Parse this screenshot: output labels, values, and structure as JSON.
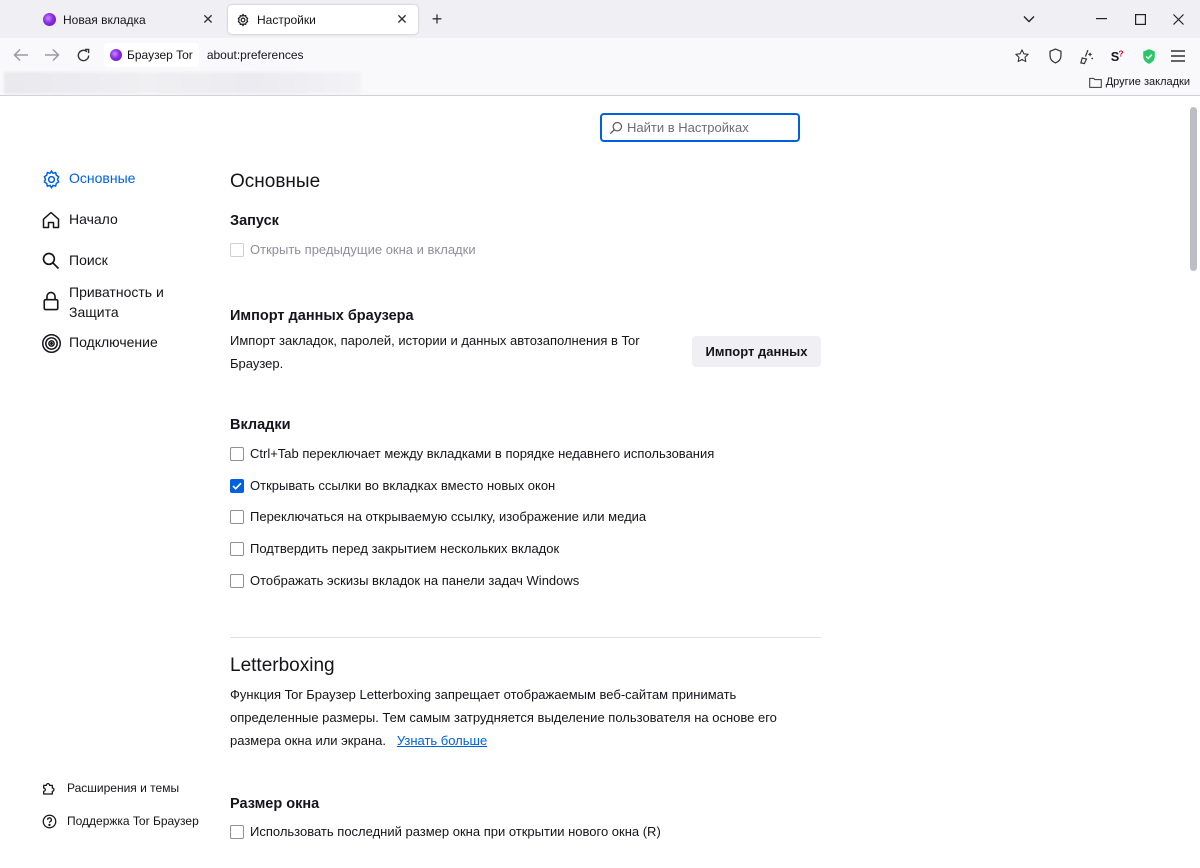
{
  "tabs": [
    {
      "label": "Новая вкладка",
      "active": false
    },
    {
      "label": "Настройки",
      "active": true
    }
  ],
  "navbar": {
    "identity_label": "Браузер Tor",
    "url": "about:preferences"
  },
  "bookmarks": {
    "other_label": "Другие закладки"
  },
  "search": {
    "placeholder": "Найти в Настройках"
  },
  "sidebar": {
    "items": [
      {
        "label": "Основные",
        "icon": "gear-icon",
        "selected": true
      },
      {
        "label": "Начало",
        "icon": "home-icon"
      },
      {
        "label": "Поиск",
        "icon": "search-icon"
      },
      {
        "label": "Приватность и\nЗащита",
        "line1": "Приватность и",
        "line2": "Защита",
        "icon": "lock-icon"
      },
      {
        "label": "Подключение",
        "icon": "connection-icon"
      }
    ],
    "footer": [
      {
        "label": "Расширения и темы",
        "icon": "puzzle-icon"
      },
      {
        "label": "Поддержка Tor Браузер",
        "icon": "help-icon"
      }
    ]
  },
  "main": {
    "title": "Основные",
    "startup": {
      "heading": "Запуск",
      "restore_label": "Открыть предыдущие окна и вкладки"
    },
    "import": {
      "heading": "Импорт данных браузера",
      "description_line1": "Импорт закладок, паролей, истории и данных автозаполнения в Tor",
      "description_line2": "Браузер.",
      "button_label": "Импорт данных"
    },
    "tabs_section": {
      "heading": "Вкладки",
      "options": [
        {
          "label": "Ctrl+Tab переключает между вкладками в порядке недавнего использования",
          "checked": false
        },
        {
          "label": "Открывать ссылки во вкладках вместо новых окон",
          "checked": true
        },
        {
          "label": "Переключаться на открываемую ссылку, изображение или медиа",
          "checked": false
        },
        {
          "label": "Подтвердить перед закрытием нескольких вкладок",
          "checked": false
        },
        {
          "label": "Отображать эскизы вкладок на панели задач Windows",
          "checked": false
        }
      ]
    },
    "letterboxing": {
      "title": "Letterboxing",
      "line1": "Функция Tor Браузер Letterboxing запрещает отображаемым веб-сайтам принимать",
      "line2": "определенные размеры. Тем самым затрудняется выделение пользователя на основе его",
      "line3": "размера окна или экрана.",
      "learn_more": "Узнать больше"
    },
    "window_size": {
      "heading": "Размер окна",
      "option_label": "Использовать последний размер окна при открытии нового окна (R)"
    }
  },
  "colors": {
    "accent": "#0061e0",
    "tor_purple": "#8a2be2",
    "noscript_red": "#d70022",
    "shield_green": "#2ac769"
  }
}
